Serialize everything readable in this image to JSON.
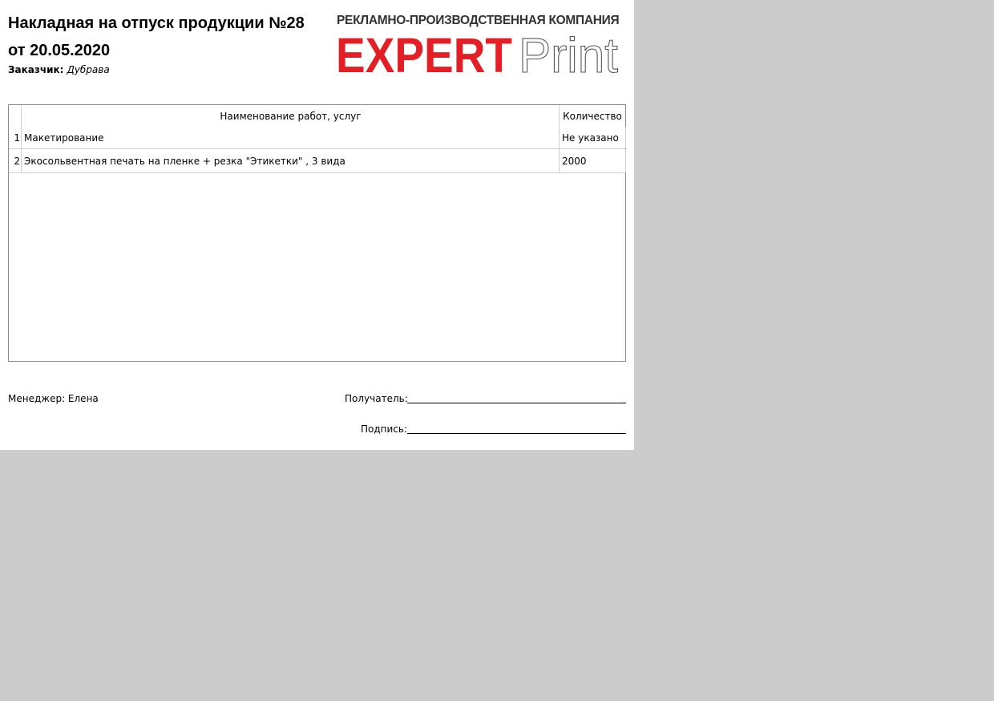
{
  "document": {
    "title_line1": "Накладная на отпуск продукции №28",
    "title_line2": "от 20.05.2020",
    "customer_label": "Заказчик:",
    "customer_value": "Дубрава"
  },
  "logo": {
    "subtitle": "РЕКЛАМНО-ПРОИЗВОДСТВЕННАЯ КОМПАНИЯ",
    "brand_bold": "EXPERT",
    "brand_light": "Print",
    "brand_color": "#e31e24"
  },
  "table": {
    "headers": {
      "name": "Наименование работ, услуг",
      "quantity": "Количество"
    },
    "rows": [
      {
        "num": "1",
        "name": "Макетирование",
        "quantity": "Не указано"
      },
      {
        "num": "2",
        "name": "Экосольвентная печать на пленке + резка \"Этикетки\" , 3 вида",
        "quantity": "2000"
      }
    ]
  },
  "footer": {
    "manager": "Менеджер: Елена",
    "recipient_label": "Получатель:",
    "signature_label": "Подпись:"
  }
}
